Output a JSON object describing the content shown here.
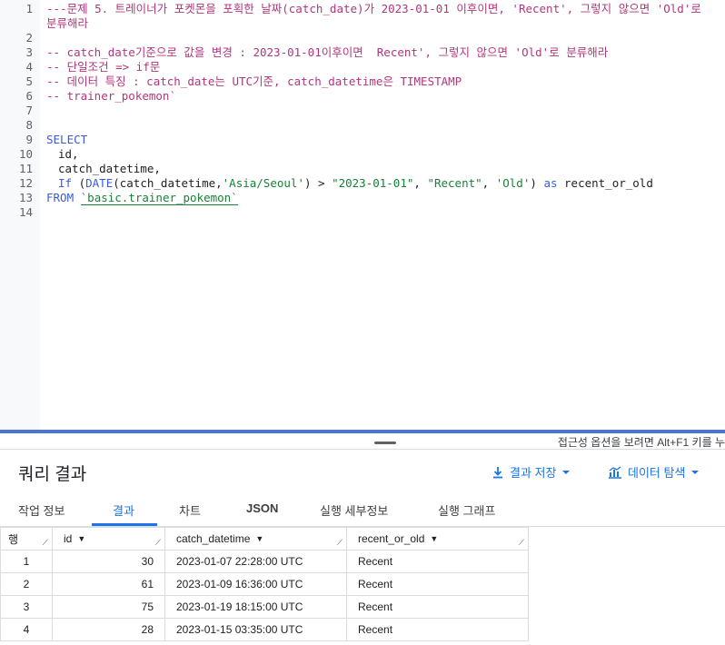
{
  "editor": {
    "line_numbers": [
      "1",
      "2",
      "3",
      "4",
      "5",
      "6",
      "7",
      "8",
      "9",
      "10",
      "11",
      "12",
      "13",
      "14"
    ],
    "line1a": "---문제 5. 트레이너가 포켓몬을 포획한 날짜(catch_date)가 2023-01-01 이후이면, 'Recent', 그렇지 않으면 'Old'로",
    "line1b": "분류해라",
    "line3": "-- catch_date기준으로 값을 변경 : 2023-01-01이후이면  Recent', 그렇지 않으면 'Old'로 분류해라",
    "line4": "-- 단일조건 => if문",
    "line5": "-- 데이터 특징 : catch_date는 UTC기준, catch_datetime은 TIMESTAMP",
    "line6": "-- trainer_pokemon`",
    "select_kw": "SELECT",
    "col_id": "id,",
    "col_dt": "catch_datetime,",
    "if_fn": "If",
    "paren_open": " (",
    "date_fn": "DATE",
    "if_args1": "(catch_datetime,",
    "tz_str": "'Asia/Seoul'",
    "if_args2": ") > ",
    "date_str": "\"2023-01-01\"",
    "comma1": ", ",
    "recent_str": "\"Recent\"",
    "comma2": ", ",
    "old_str": "'Old'",
    "close": ") ",
    "as_kw": "as",
    "alias": " recent_or_old",
    "from_kw": "FROM",
    "table_ref": "`basic.trainer_pokemon`"
  },
  "toolbar": {
    "a11y_hint": "접근성 옵션을 보려면 Alt+F1 키를 누",
    "results_title": "쿼리 결과",
    "save_label": "결과 저장",
    "explore_label": "데이터 탐색"
  },
  "tabs": [
    {
      "label": "작업 정보"
    },
    {
      "label": "결과"
    },
    {
      "label": "차트"
    },
    {
      "label": "JSON"
    },
    {
      "label": "실행 세부정보"
    },
    {
      "label": "실행 그래프"
    }
  ],
  "table": {
    "headers": [
      "행",
      "id",
      "catch_datetime",
      "recent_or_old"
    ],
    "rows": [
      {
        "row": "1",
        "id": "30",
        "dt": "2023-01-07 22:28:00 UTC",
        "ro": "Recent"
      },
      {
        "row": "2",
        "id": "61",
        "dt": "2023-01-09 16:36:00 UTC",
        "ro": "Recent"
      },
      {
        "row": "3",
        "id": "75",
        "dt": "2023-01-19 18:15:00 UTC",
        "ro": "Recent"
      },
      {
        "row": "4",
        "id": "28",
        "dt": "2023-01-15 03:35:00 UTC",
        "ro": "Recent"
      }
    ]
  },
  "colors": {
    "accent": "#1a73e8",
    "divider": "#4a74d6"
  }
}
